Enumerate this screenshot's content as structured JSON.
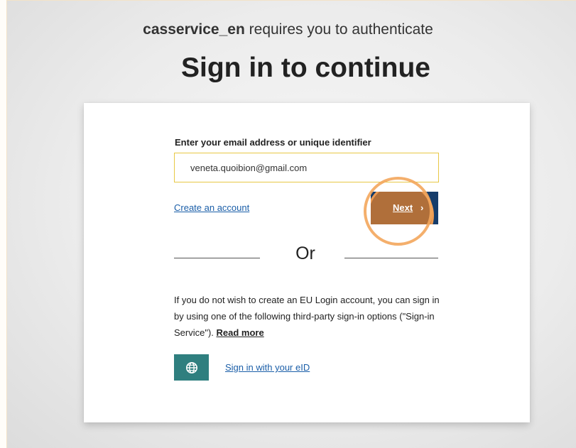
{
  "auth": {
    "service_name": "casservice_en",
    "requires_text": " requires you to authenticate",
    "heading": "Sign in to continue"
  },
  "form": {
    "email_label": "Enter your email address or unique identifier",
    "email_value": "veneta.quoibion@gmail.com",
    "create_account": "Create an account",
    "next_label": "Next",
    "next_chevron": "›"
  },
  "divider": {
    "or_text": "Or"
  },
  "third_party": {
    "info_text": "If you do not wish to create an EU Login account, you can sign in by using one of the following third-party sign-in options (\"Sign-in Service\"). ",
    "read_more": "Read more",
    "eid_link": "Sign in with your eID",
    "eid_icon": "globe-icon"
  },
  "colors": {
    "next_button": "#153c6a",
    "highlight": "#ed8428",
    "eid_icon_bg": "#2f7f7f",
    "link": "#1a5ea8",
    "input_border": "#e8c845"
  }
}
